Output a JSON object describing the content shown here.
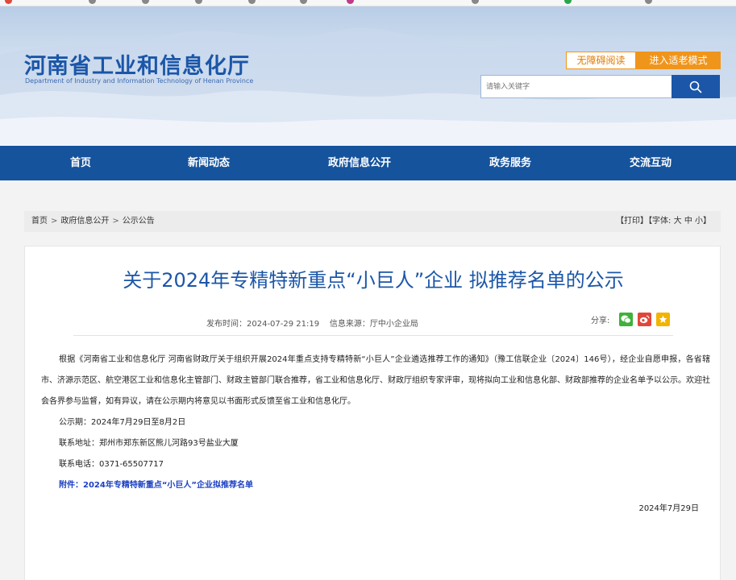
{
  "header": {
    "title": "河南省工业和信息化厅",
    "subtitle": "Department of Industry and Information Technology of Henan Province",
    "accessibility_label": "无障碍阅读",
    "elder_mode_label": "进入适老模式",
    "search_placeholder": "请输入关键字"
  },
  "nav": {
    "items": [
      {
        "label": "首页"
      },
      {
        "label": "新闻动态"
      },
      {
        "label": "政府信息公开"
      },
      {
        "label": "政务服务"
      },
      {
        "label": "交流互动"
      }
    ]
  },
  "breadcrumb": {
    "items": [
      "首页",
      "政府信息公开",
      "公示公告"
    ],
    "separator": ">"
  },
  "tools": {
    "print_label": "【打印】",
    "font_label": "【字体:",
    "font_large": "大",
    "font_medium": "中",
    "font_small": "小】"
  },
  "article": {
    "title": "关于2024年专精特新重点“小巨人”企业 拟推荐名单的公示",
    "publish_time": "发布时间：2024-07-29 21:19",
    "source": "信息来源：厅中小企业局",
    "share_label": "分享:",
    "body": "根据《河南省工业和信息化厅 河南省财政厅关于组织开展2024年重点支持专精特新“小巨人”企业遴选推荐工作的通知》（豫工信联企业〔2024〕146号），经企业自愿申报，各省辖市、济源示范区、航空港区工业和信息化主管部门、财政主管部门联合推荐，省工业和信息化厅、财政厅组织专家评审，现将拟向工业和信息化部、财政部推荐的企业名单予以公示。欢迎社会各界参与监督，如有异议，请在公示期内将意见以书面形式反馈至省工业和信息化厅。",
    "period": "公示期：2024年7月29日至8月2日",
    "address": "联系地址：郑州市郑东新区熊儿河路93号盐业大厦",
    "phone": "联系电话：0371-65507717",
    "attachment": "附件：2024年专精特新重点“小巨人”企业拟推荐名单",
    "sign_date": "2024年7月29日"
  },
  "colors": {
    "brand_blue": "#1b56a8",
    "nav_blue": "#15539c",
    "orange": "#f0951c",
    "link_blue": "#1b3fc2",
    "wechat_green": "#3fb13b",
    "weibo_red": "#e0473a",
    "favorite_yellow": "#f2b400"
  }
}
